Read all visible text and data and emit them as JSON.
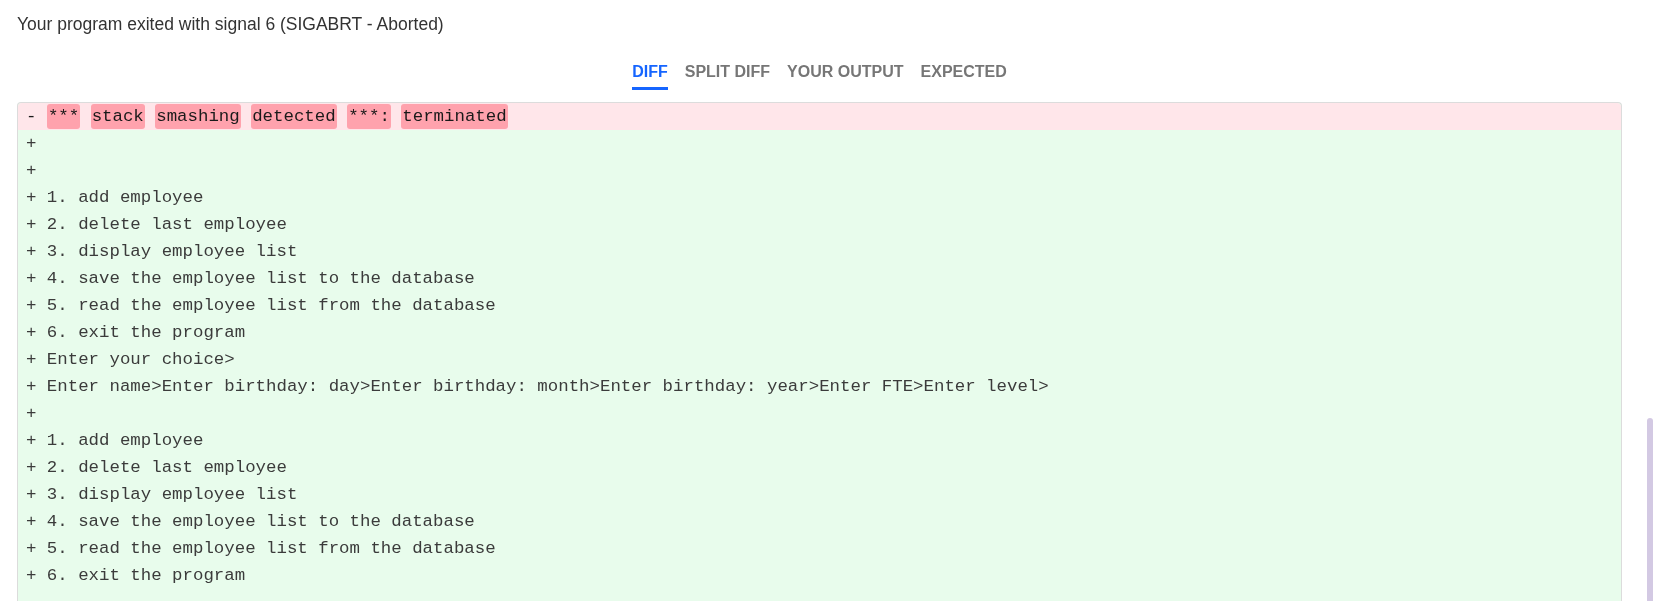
{
  "message": "Your program exited with signal 6 (SIGABRT - Aborted)",
  "tabs": [
    {
      "label": "DIFF",
      "selected": true
    },
    {
      "label": "SPLIT DIFF",
      "selected": false
    },
    {
      "label": "YOUR OUTPUT",
      "selected": false
    },
    {
      "label": "EXPECTED",
      "selected": false
    }
  ],
  "diff": {
    "lines": [
      {
        "kind": "removed",
        "prefix": "-",
        "words": [
          {
            "text": "***",
            "changed": true
          },
          {
            "text": "stack",
            "changed": true
          },
          {
            "text": "smashing",
            "changed": true
          },
          {
            "text": "detected",
            "changed": true
          },
          {
            "text": "***:",
            "changed": true
          },
          {
            "text": "terminated",
            "changed": true
          }
        ]
      },
      {
        "kind": "added",
        "text": "+"
      },
      {
        "kind": "added",
        "text": "+"
      },
      {
        "kind": "added",
        "text": "+ 1. add employee"
      },
      {
        "kind": "added",
        "text": "+ 2. delete last employee"
      },
      {
        "kind": "added",
        "text": "+ 3. display employee list"
      },
      {
        "kind": "added",
        "text": "+ 4. save the employee list to the database"
      },
      {
        "kind": "added",
        "text": "+ 5. read the employee list from the database"
      },
      {
        "kind": "added",
        "text": "+ 6. exit the program"
      },
      {
        "kind": "added",
        "text": "+ Enter your choice>"
      },
      {
        "kind": "added",
        "text": "+ Enter name>Enter birthday: day>Enter birthday: month>Enter birthday: year>Enter FTE>Enter level>"
      },
      {
        "kind": "added",
        "text": "+"
      },
      {
        "kind": "added",
        "text": "+ 1. add employee"
      },
      {
        "kind": "added",
        "text": "+ 2. delete last employee"
      },
      {
        "kind": "added",
        "text": "+ 3. display employee list"
      },
      {
        "kind": "added",
        "text": "+ 4. save the employee list to the database"
      },
      {
        "kind": "added",
        "text": "+ 5. read the employee list from the database"
      },
      {
        "kind": "added",
        "text": "+ 6. exit the program"
      }
    ]
  }
}
